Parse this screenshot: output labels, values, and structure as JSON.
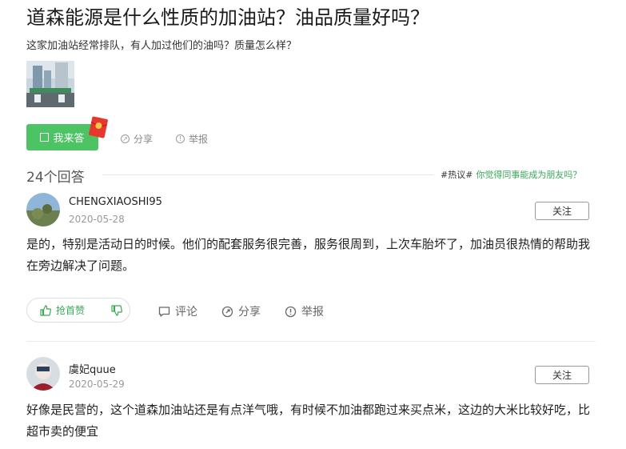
{
  "question": {
    "title": "道森能源是什么性质的加油站？油品质量好吗？",
    "description": "这家加油站经常排队，有人加过他们的油吗？质量怎么样？",
    "answer_button_label": "我来答",
    "share_label": "分享",
    "report_label": "举报"
  },
  "answers_header": {
    "count_label": "24个回答",
    "hot_tag": "#热议#",
    "hot_link": "你觉得同事能成为朋友吗？"
  },
  "answers": [
    {
      "username": "CHENGXIAOSHI95",
      "date": "2020-05-28",
      "follow_label": "关注",
      "text": "是的，特别是活动日的时候。他们的配套服务很完善，服务很周到，上次车胎坏了，加油员很热情的帮助我在旁边解决了问题。",
      "vote_label": "抢首赞",
      "comment_label": "评论",
      "share_label": "分享",
      "report_label": "举报"
    },
    {
      "username": "虞妃quue",
      "date": "2020-05-29",
      "follow_label": "关注",
      "text": "好像是民营的，这个道森加油站还是有点洋气哦，有时候不加油都跑过来买点米，这边的大米比较好吃，比超市卖的便宜"
    }
  ],
  "colors": {
    "accent_green": "#4cc463",
    "link_green": "#3aa757",
    "red_packet": "#e8372f"
  }
}
